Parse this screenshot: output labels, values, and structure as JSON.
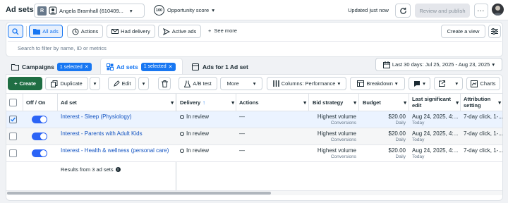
{
  "header": {
    "title": "Ad sets",
    "account_initial": "R",
    "account_name": "Angela Bramhall (610409...",
    "score_badge": "100",
    "score_label": "Opportunity score",
    "updated": "Updated just now",
    "review_publish": "Review and publish"
  },
  "filters": {
    "all_ads": "All ads",
    "actions": "Actions",
    "had_delivery": "Had delivery",
    "active_ads": "Active ads",
    "see_more": "See more",
    "create_view": "Create a view",
    "search_placeholder": "Search to filter by name, ID or metrics"
  },
  "tabs": {
    "campaigns": "Campaigns",
    "campaigns_selected": "1 selected",
    "adsets": "Ad sets",
    "adsets_selected": "1 selected",
    "ads": "Ads for 1 Ad set",
    "date_range": "Last 30 days: Jul 25, 2025 - Aug 23, 2025"
  },
  "toolbar": {
    "create": "Create",
    "duplicate": "Duplicate",
    "edit": "Edit",
    "ab_test": "A/B test",
    "more": "More",
    "columns": "Columns: Performance",
    "breakdown": "Breakdown",
    "charts": "Charts"
  },
  "columns": {
    "off_on": "Off / On",
    "ad_set": "Ad set",
    "delivery": "Delivery",
    "actions": "Actions",
    "bid_strategy": "Bid strategy",
    "budget": "Budget",
    "last_edit_1": "Last significant",
    "last_edit_2": "edit",
    "attribution_1": "Attribution",
    "attribution_2": "setting"
  },
  "rows": [
    {
      "name": "Interest - Sleep (Physiology)",
      "delivery": "In review",
      "actions": "—",
      "bid": "Highest volume",
      "bid_sub": "Conversions",
      "budget": "$20.00",
      "budget_sub": "Daily",
      "edit": "Aug 24, 2025, 4:...",
      "edit_sub": "Today",
      "attribution": "7-day click, 1-...",
      "checked": true
    },
    {
      "name": "Interest - Parents with Adult Kids",
      "delivery": "In review",
      "actions": "—",
      "bid": "Highest volume",
      "bid_sub": "Conversions",
      "budget": "$20.00",
      "budget_sub": "Daily",
      "edit": "Aug 24, 2025, 4:...",
      "edit_sub": "Today",
      "attribution": "7-day click, 1-...",
      "checked": false
    },
    {
      "name": "Interest - Health & wellness (personal care)",
      "delivery": "In review",
      "actions": "—",
      "bid": "Highest volume",
      "bid_sub": "Conversions",
      "budget": "$20.00",
      "budget_sub": "Daily",
      "edit": "Aug 24, 2025, 4:...",
      "edit_sub": "Today",
      "attribution": "7-day click, 1-...",
      "checked": false
    }
  ],
  "footer": {
    "results": "Results from 3 ad sets"
  },
  "colors": {
    "accent": "#1877f2",
    "create": "#1f6e43",
    "toggle": "#2c64f6"
  }
}
